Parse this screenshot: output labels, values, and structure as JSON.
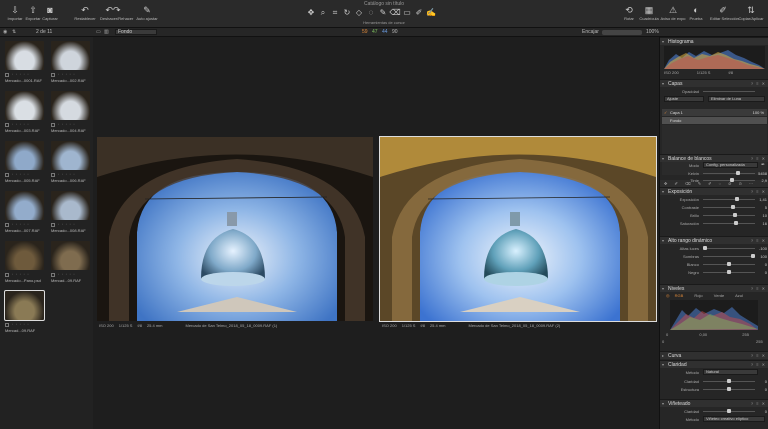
{
  "window": {
    "title": "Catálogo sin título"
  },
  "toolbar": {
    "left": [
      {
        "icon": "import-icon",
        "label": "Importar"
      },
      {
        "icon": "export-icon",
        "label": "Exportar"
      },
      {
        "icon": "camera-icon",
        "label": "Capturar"
      },
      {
        "icon": "reset-icon",
        "label": "Restablecer"
      },
      {
        "icon": "undo-redo-icon",
        "label": "Deshacer/Rehacer"
      },
      {
        "icon": "auto-adjust-icon",
        "label": "Auto ajustar"
      }
    ],
    "center_label": "Herramientas de cursor",
    "right": [
      {
        "icon": "rotate-icon",
        "label": "Rotar"
      },
      {
        "icon": "grid-icon",
        "label": "Cuadrícula"
      },
      {
        "icon": "exposure-warning-icon",
        "label": "Aviso de expo"
      },
      {
        "icon": "proof-icon",
        "label": "Prueba"
      },
      {
        "icon": "edit-selection-icon",
        "label": "Editar Selección"
      },
      {
        "icon": "copy-apply-icon",
        "label": "Copiar/Aplicar"
      }
    ]
  },
  "bar2": {
    "count": "2 de 11",
    "layer": "Fondo",
    "v1": "59",
    "v2": "47",
    "v3": "44",
    "v4": "90",
    "fit": "Encajar",
    "zoom": "100%"
  },
  "filmstrip": [
    {
      "name": "Mercado...0001.RAF"
    },
    {
      "name": "Mercado...002.RAF"
    },
    {
      "name": "Mercado...003.RAF"
    },
    {
      "name": "Mercado...004.RAF"
    },
    {
      "name": "Mercado...005.RAF"
    },
    {
      "name": "Mercado...006.RAF"
    },
    {
      "name": "Mercado...007.RAF"
    },
    {
      "name": "Mercado...008.RAF"
    },
    {
      "name": "Mercado...Pano.psd"
    },
    {
      "name": "Mercad...09.RAF"
    },
    {
      "name": "Mercad...09.RAF"
    }
  ],
  "viewer": {
    "left": {
      "iso": "ISO 200",
      "shutter": "1/125 S",
      "aperture": "f/8",
      "focal": "25.4 mm",
      "file": "Mercado de San Telmo_2018_05_18_0009.RAF (1)"
    },
    "right": {
      "iso": "ISO 200",
      "shutter": "1/125 S",
      "aperture": "f/8",
      "focal": "25.4 mm",
      "file": "Mercado de San Telmo_2018_05_18_0009.RAF (2)"
    }
  },
  "panel": {
    "histogram": {
      "title": "Histograma",
      "iso": "ISO 200",
      "shutter": "1/125 S",
      "aperture": "f/8"
    },
    "layers": {
      "title": "Capas",
      "opacity_label": "Opacidad",
      "adjust": "Ajuste",
      "fill": "Eliminar de Luna",
      "layer1": "Capa 1",
      "layer1_val": "100 %",
      "background": "Fondo"
    },
    "white_balance": {
      "title": "Balance de blancos",
      "mode_label": "Modo",
      "mode": "Config. personalizada",
      "kelvin_label": "Kelvin",
      "kelvin": "5458",
      "tint_label": "Tinte",
      "tint": "2,9"
    },
    "exposure": {
      "title": "Exposición",
      "rows": [
        {
          "label": "Exposición",
          "value": "1,41"
        },
        {
          "label": "Contraste",
          "value": "5"
        },
        {
          "label": "Brillo",
          "value": "10"
        },
        {
          "label": "Saturación",
          "value": "16"
        }
      ]
    },
    "hdr": {
      "title": "Alto rango dinámico",
      "rows": [
        {
          "label": "Altas luces",
          "value": "-100"
        },
        {
          "label": "Sombras",
          "value": "100"
        },
        {
          "label": "Blanco",
          "value": "0"
        },
        {
          "label": "Negro",
          "value": "0"
        }
      ]
    },
    "levels": {
      "title": "Niveles",
      "tabs": [
        "RGB",
        "Rojo",
        "Verde",
        "Azul"
      ],
      "low": "0",
      "mid": "0,00",
      "high": "255",
      "in_low": "0",
      "in_high": "255"
    },
    "curve": {
      "title": "Curva"
    },
    "clarity": {
      "title": "Claridad",
      "method_label": "Método",
      "method": "Natural",
      "rows": [
        {
          "label": "Claridad",
          "value": "0"
        },
        {
          "label": "Estructura",
          "value": "0"
        }
      ]
    },
    "vignette": {
      "title": "Viñeteado",
      "rows": [
        {
          "label": "Claridad",
          "value": "0"
        }
      ],
      "method_label": "Método",
      "method": "Viñeteo creativo elíptico"
    }
  }
}
